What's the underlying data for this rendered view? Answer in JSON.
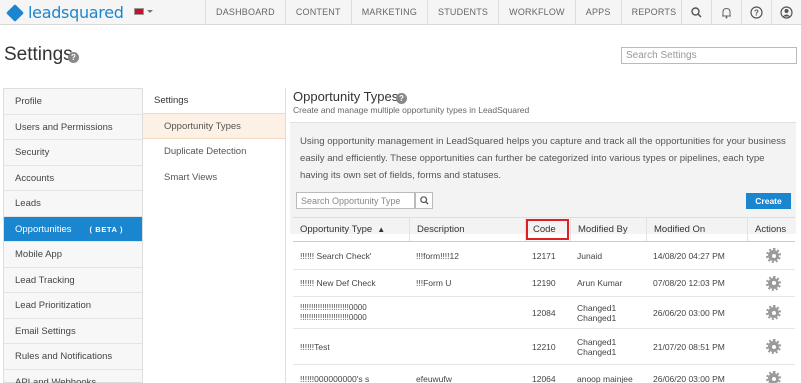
{
  "brand": {
    "name": "leadsquared"
  },
  "nav": {
    "items": [
      "DASHBOARD",
      "CONTENT",
      "MARKETING",
      "STUDENTS",
      "WORKFLOW",
      "APPS",
      "REPORTS"
    ],
    "icons": [
      "search-icon",
      "bell-icon",
      "help-icon",
      "user-icon"
    ]
  },
  "page": {
    "title": "Settings",
    "search_placeholder": "Search Settings"
  },
  "sidebar": {
    "items": [
      {
        "label": "Profile"
      },
      {
        "label": "Users and Permissions"
      },
      {
        "label": "Security"
      },
      {
        "label": "Accounts"
      },
      {
        "label": "Leads"
      },
      {
        "label": "Opportunities",
        "badge": "( BETA )"
      },
      {
        "label": "Mobile App"
      },
      {
        "label": "Lead Tracking"
      },
      {
        "label": "Lead Prioritization"
      },
      {
        "label": "Email Settings"
      },
      {
        "label": "Rules and Notifications"
      },
      {
        "label": "API and Webhooks"
      }
    ]
  },
  "subnav": {
    "title": "Settings",
    "items": [
      {
        "label": "Opportunity Types"
      },
      {
        "label": "Duplicate Detection"
      },
      {
        "label": "Smart Views"
      }
    ]
  },
  "main": {
    "title": "Opportunity Types",
    "subtitle": "Create and manage multiple opportunity types in LeadSquared",
    "info": "Using opportunity management in LeadSquared helps you capture and track all the opportunities for your business easily and efficiently. These opportunities can further be categorized into various types or pipelines, each type having its own set of fields, forms and statuses.",
    "search_placeholder": "Search Opportunity Type",
    "create_label": "Create"
  },
  "table": {
    "headers": [
      "Opportunity Type",
      "Description",
      "Code",
      "Modified By",
      "Modified On",
      "Actions"
    ],
    "sort_indicator": "▲",
    "rows": [
      {
        "type": "!!!!!! Search Check'",
        "desc": "!!!form!!!!12",
        "code": "12171",
        "by": [
          "Junaid"
        ],
        "on": "14/08/20 04:27 PM"
      },
      {
        "type": "!!!!!! New Def Check",
        "desc": "!!!Form U",
        "code": "12190",
        "by": [
          "Arun Kumar"
        ],
        "on": "07/08/20 12:03 PM"
      },
      {
        "type": "!!!!!!!!!!!!!!!!!!!!!!0000 !!!!!!!!!!!!!!!!!!!!!!0000",
        "desc": "",
        "code": "12084",
        "by": [
          "Changed1",
          "Changed1"
        ],
        "on": "26/06/20 03:00 PM"
      },
      {
        "type": "!!!!!!Test",
        "desc": "",
        "code": "12210",
        "by": [
          "Changed1",
          "Changed1"
        ],
        "on": "21/07/20 08:51 PM"
      },
      {
        "type": "!!!!!!000000000's s",
        "desc": "efeuwufw",
        "code": "12064",
        "by": [
          "anoop mainjee"
        ],
        "on": "26/06/20 03:00 PM"
      }
    ]
  }
}
